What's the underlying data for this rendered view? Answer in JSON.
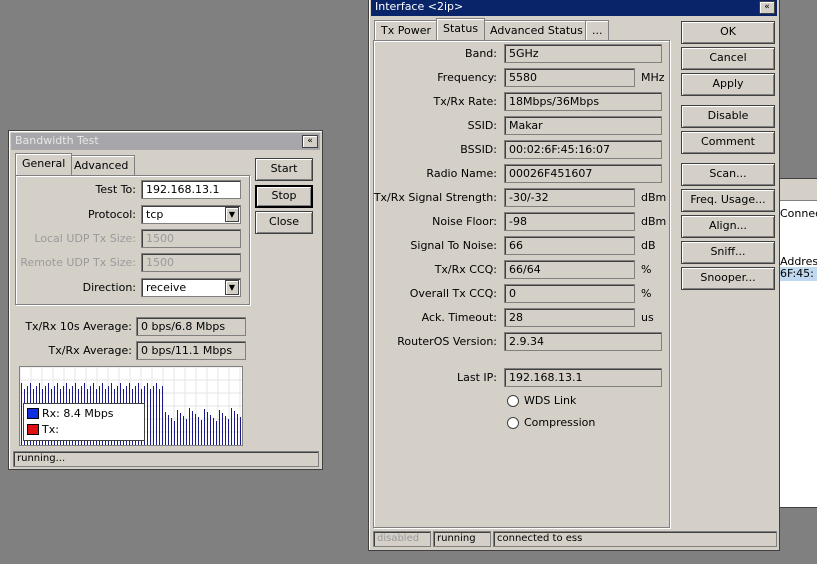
{
  "bandwidth": {
    "title": "Bandwidth Test",
    "title_btn": "«",
    "tabs": [
      "General",
      "Advanced"
    ],
    "labels": {
      "test_to": "Test To:",
      "protocol": "Protocol:",
      "local_udp": "Local UDP Tx Size:",
      "remote_udp": "Remote UDP Tx Size:",
      "direction": "Direction:",
      "avg10": "Tx/Rx 10s Average:",
      "avg": "Tx/Rx Average:"
    },
    "values": {
      "test_to": "192.168.13.1",
      "protocol": "tcp",
      "local_udp": "1500",
      "remote_udp": "1500",
      "direction": "receive",
      "avg10": "0 bps/6.8 Mbps",
      "avg": "0 bps/11.1 Mbps"
    },
    "buttons": {
      "start": "Start",
      "stop": "Stop",
      "close": "Close"
    },
    "legend": {
      "rx": "Rx:  8.4 Mbps",
      "tx": "Tx:"
    },
    "colors": {
      "rx": "#1030e0",
      "tx": "#e01010",
      "bars": "#1a1a8a"
    },
    "status": "running..."
  },
  "interface": {
    "title": "Interface <2ip>",
    "title_btn": "«",
    "tabs": [
      "Tx Power",
      "Status",
      "Advanced Status",
      "..."
    ],
    "rows": [
      {
        "label": "Band:",
        "value": "5GHz",
        "unit": ""
      },
      {
        "label": "Frequency:",
        "value": "5580",
        "unit": "MHz"
      },
      {
        "label": "Tx/Rx Rate:",
        "value": "18Mbps/36Mbps",
        "unit": ""
      },
      {
        "label": "SSID:",
        "value": "Makar",
        "unit": ""
      },
      {
        "label": "BSSID:",
        "value": "00:02:6F:45:16:07",
        "unit": ""
      },
      {
        "label": "Radio Name:",
        "value": "00026F451607",
        "unit": ""
      },
      {
        "label": "Tx/Rx Signal Strength:",
        "value": "-30/-32",
        "unit": "dBm"
      },
      {
        "label": "Noise Floor:",
        "value": "-98",
        "unit": "dBm"
      },
      {
        "label": "Signal To Noise:",
        "value": "66",
        "unit": "dB"
      },
      {
        "label": "Tx/Rx CCQ:",
        "value": "66/64",
        "unit": "%"
      },
      {
        "label": "Overall Tx CCQ:",
        "value": "0",
        "unit": "%"
      },
      {
        "label": "Ack. Timeout:",
        "value": "28",
        "unit": "us"
      },
      {
        "label": "RouterOS Version:",
        "value": "2.9.34",
        "unit": ""
      }
    ],
    "last_ip_label": "Last IP:",
    "last_ip": "192.168.13.1",
    "wds_link": "WDS Link",
    "compression": "Compression",
    "buttons": [
      "OK",
      "Cancel",
      "Apply",
      "Disable",
      "Comment",
      "Scan...",
      "Freq. Usage...",
      "Align...",
      "Sniff...",
      "Snooper..."
    ],
    "status": [
      "disabled",
      "running",
      "connected to ess"
    ]
  },
  "background": {
    "col1": "Connect",
    "col2": "Address",
    "cell": "6F:45:"
  }
}
